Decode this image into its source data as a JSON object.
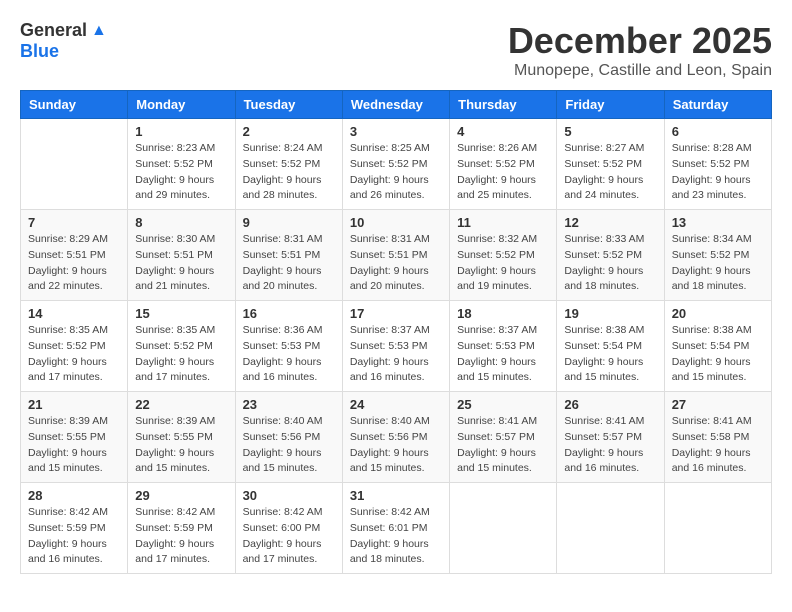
{
  "header": {
    "logo_general": "General",
    "logo_blue": "Blue",
    "month_title": "December 2025",
    "location": "Munopepe, Castille and Leon, Spain"
  },
  "days_of_week": [
    "Sunday",
    "Monday",
    "Tuesday",
    "Wednesday",
    "Thursday",
    "Friday",
    "Saturday"
  ],
  "weeks": [
    [
      {
        "day": "",
        "info": ""
      },
      {
        "day": "1",
        "info": "Sunrise: 8:23 AM\nSunset: 5:52 PM\nDaylight: 9 hours\nand 29 minutes."
      },
      {
        "day": "2",
        "info": "Sunrise: 8:24 AM\nSunset: 5:52 PM\nDaylight: 9 hours\nand 28 minutes."
      },
      {
        "day": "3",
        "info": "Sunrise: 8:25 AM\nSunset: 5:52 PM\nDaylight: 9 hours\nand 26 minutes."
      },
      {
        "day": "4",
        "info": "Sunrise: 8:26 AM\nSunset: 5:52 PM\nDaylight: 9 hours\nand 25 minutes."
      },
      {
        "day": "5",
        "info": "Sunrise: 8:27 AM\nSunset: 5:52 PM\nDaylight: 9 hours\nand 24 minutes."
      },
      {
        "day": "6",
        "info": "Sunrise: 8:28 AM\nSunset: 5:52 PM\nDaylight: 9 hours\nand 23 minutes."
      }
    ],
    [
      {
        "day": "7",
        "info": "Sunrise: 8:29 AM\nSunset: 5:51 PM\nDaylight: 9 hours\nand 22 minutes."
      },
      {
        "day": "8",
        "info": "Sunrise: 8:30 AM\nSunset: 5:51 PM\nDaylight: 9 hours\nand 21 minutes."
      },
      {
        "day": "9",
        "info": "Sunrise: 8:31 AM\nSunset: 5:51 PM\nDaylight: 9 hours\nand 20 minutes."
      },
      {
        "day": "10",
        "info": "Sunrise: 8:31 AM\nSunset: 5:51 PM\nDaylight: 9 hours\nand 20 minutes."
      },
      {
        "day": "11",
        "info": "Sunrise: 8:32 AM\nSunset: 5:52 PM\nDaylight: 9 hours\nand 19 minutes."
      },
      {
        "day": "12",
        "info": "Sunrise: 8:33 AM\nSunset: 5:52 PM\nDaylight: 9 hours\nand 18 minutes."
      },
      {
        "day": "13",
        "info": "Sunrise: 8:34 AM\nSunset: 5:52 PM\nDaylight: 9 hours\nand 18 minutes."
      }
    ],
    [
      {
        "day": "14",
        "info": "Sunrise: 8:35 AM\nSunset: 5:52 PM\nDaylight: 9 hours\nand 17 minutes."
      },
      {
        "day": "15",
        "info": "Sunrise: 8:35 AM\nSunset: 5:52 PM\nDaylight: 9 hours\nand 17 minutes."
      },
      {
        "day": "16",
        "info": "Sunrise: 8:36 AM\nSunset: 5:53 PM\nDaylight: 9 hours\nand 16 minutes."
      },
      {
        "day": "17",
        "info": "Sunrise: 8:37 AM\nSunset: 5:53 PM\nDaylight: 9 hours\nand 16 minutes."
      },
      {
        "day": "18",
        "info": "Sunrise: 8:37 AM\nSunset: 5:53 PM\nDaylight: 9 hours\nand 15 minutes."
      },
      {
        "day": "19",
        "info": "Sunrise: 8:38 AM\nSunset: 5:54 PM\nDaylight: 9 hours\nand 15 minutes."
      },
      {
        "day": "20",
        "info": "Sunrise: 8:38 AM\nSunset: 5:54 PM\nDaylight: 9 hours\nand 15 minutes."
      }
    ],
    [
      {
        "day": "21",
        "info": "Sunrise: 8:39 AM\nSunset: 5:55 PM\nDaylight: 9 hours\nand 15 minutes."
      },
      {
        "day": "22",
        "info": "Sunrise: 8:39 AM\nSunset: 5:55 PM\nDaylight: 9 hours\nand 15 minutes."
      },
      {
        "day": "23",
        "info": "Sunrise: 8:40 AM\nSunset: 5:56 PM\nDaylight: 9 hours\nand 15 minutes."
      },
      {
        "day": "24",
        "info": "Sunrise: 8:40 AM\nSunset: 5:56 PM\nDaylight: 9 hours\nand 15 minutes."
      },
      {
        "day": "25",
        "info": "Sunrise: 8:41 AM\nSunset: 5:57 PM\nDaylight: 9 hours\nand 15 minutes."
      },
      {
        "day": "26",
        "info": "Sunrise: 8:41 AM\nSunset: 5:57 PM\nDaylight: 9 hours\nand 16 minutes."
      },
      {
        "day": "27",
        "info": "Sunrise: 8:41 AM\nSunset: 5:58 PM\nDaylight: 9 hours\nand 16 minutes."
      }
    ],
    [
      {
        "day": "28",
        "info": "Sunrise: 8:42 AM\nSunset: 5:59 PM\nDaylight: 9 hours\nand 16 minutes."
      },
      {
        "day": "29",
        "info": "Sunrise: 8:42 AM\nSunset: 5:59 PM\nDaylight: 9 hours\nand 17 minutes."
      },
      {
        "day": "30",
        "info": "Sunrise: 8:42 AM\nSunset: 6:00 PM\nDaylight: 9 hours\nand 17 minutes."
      },
      {
        "day": "31",
        "info": "Sunrise: 8:42 AM\nSunset: 6:01 PM\nDaylight: 9 hours\nand 18 minutes."
      },
      {
        "day": "",
        "info": ""
      },
      {
        "day": "",
        "info": ""
      },
      {
        "day": "",
        "info": ""
      }
    ]
  ]
}
